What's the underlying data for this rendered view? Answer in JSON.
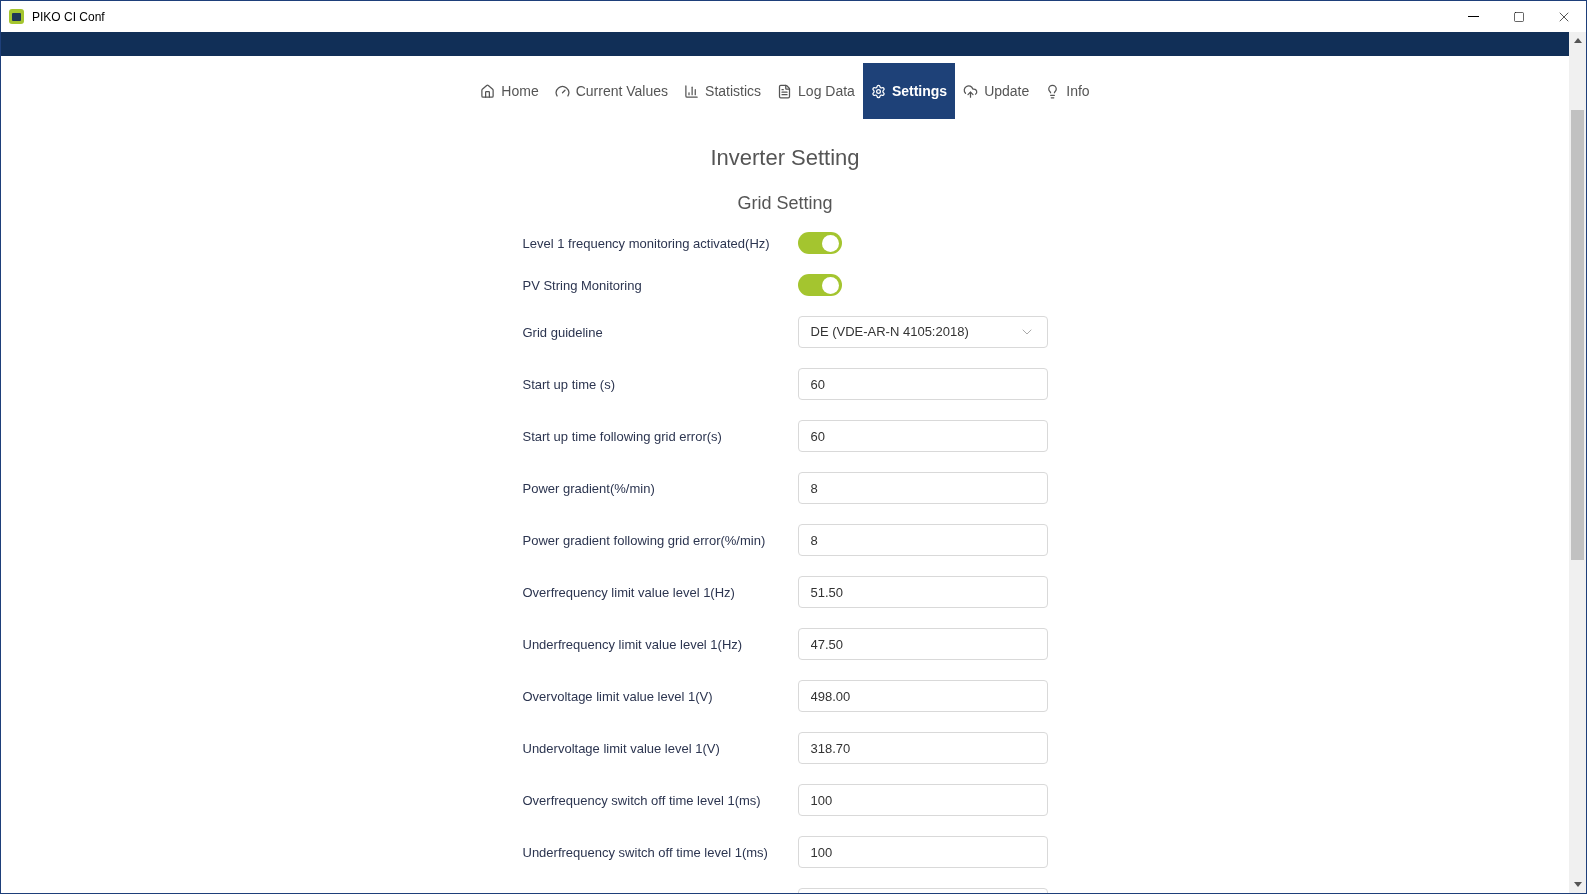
{
  "window": {
    "title": "PIKO CI Conf"
  },
  "tabs": [
    {
      "label": "Home",
      "selected": false
    },
    {
      "label": "Current Values",
      "selected": false
    },
    {
      "label": "Statistics",
      "selected": false
    },
    {
      "label": "Log Data",
      "selected": false
    },
    {
      "label": "Settings",
      "selected": true
    },
    {
      "label": "Update",
      "selected": false
    },
    {
      "label": "Info",
      "selected": false
    }
  ],
  "heading": "Inverter Setting",
  "section": "Grid Setting",
  "rows": [
    {
      "kind": "toggle",
      "label": "Level 1 frequency monitoring activated(Hz)",
      "on": true
    },
    {
      "kind": "toggle",
      "label": "PV String Monitoring",
      "on": true
    },
    {
      "kind": "select",
      "label": "Grid guideline",
      "value": "DE (VDE-AR-N 4105:2018)"
    },
    {
      "kind": "input",
      "label": "Start up time (s)",
      "value": "60"
    },
    {
      "kind": "input",
      "label": "Start up time following grid error(s)",
      "value": "60"
    },
    {
      "kind": "input",
      "label": "Power gradient(%/min)",
      "value": "8"
    },
    {
      "kind": "input",
      "label": "Power gradient following grid error(%/min)",
      "value": "8"
    },
    {
      "kind": "input",
      "label": "Overfrequency limit value level 1(Hz)",
      "value": "51.50"
    },
    {
      "kind": "input",
      "label": "Underfrequency limit value level 1(Hz)",
      "value": "47.50"
    },
    {
      "kind": "input",
      "label": "Overvoltage limit value level 1(V)",
      "value": "498.00"
    },
    {
      "kind": "input",
      "label": "Undervoltage limit value level 1(V)",
      "value": "318.70"
    },
    {
      "kind": "input",
      "label": "Overfrequency switch off time level 1(ms)",
      "value": "100"
    },
    {
      "kind": "input",
      "label": "Underfrequency switch off time level 1(ms)",
      "value": "100"
    },
    {
      "kind": "input"
    }
  ]
}
